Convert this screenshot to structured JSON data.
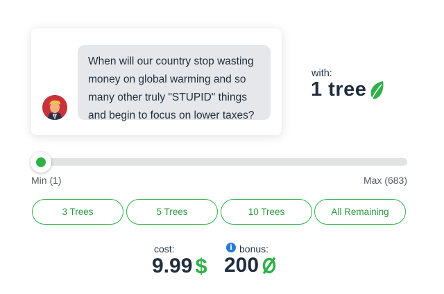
{
  "tweet": {
    "text": "When will our country stop wasting money on global warming and so many other truly \"STUPID\" things and begin to focus on lower taxes?"
  },
  "offer": {
    "with_label": "with:",
    "tree_count": "1 tree",
    "icon": "leaf-icon"
  },
  "slider": {
    "min_label": "Min (1)",
    "max_label": "Max (683)",
    "value": 1,
    "min": 1,
    "max": 683
  },
  "quick_buttons": [
    "3 Trees",
    "5 Trees",
    "10 Trees",
    "All Remaining"
  ],
  "summary": {
    "cost_label": "cost:",
    "cost_value": "9.99",
    "cost_currency": "$",
    "bonus_label": "bonus:",
    "bonus_value": "200",
    "bonus_icon": "green-slashed-zero-currency-icon"
  },
  "colors": {
    "accent_green": "#2fb14a",
    "text_dark": "#1f2d3d",
    "info_blue": "#2878d6",
    "bubble_gray": "#e5e7ea",
    "track_gray": "#e2e3e5"
  }
}
